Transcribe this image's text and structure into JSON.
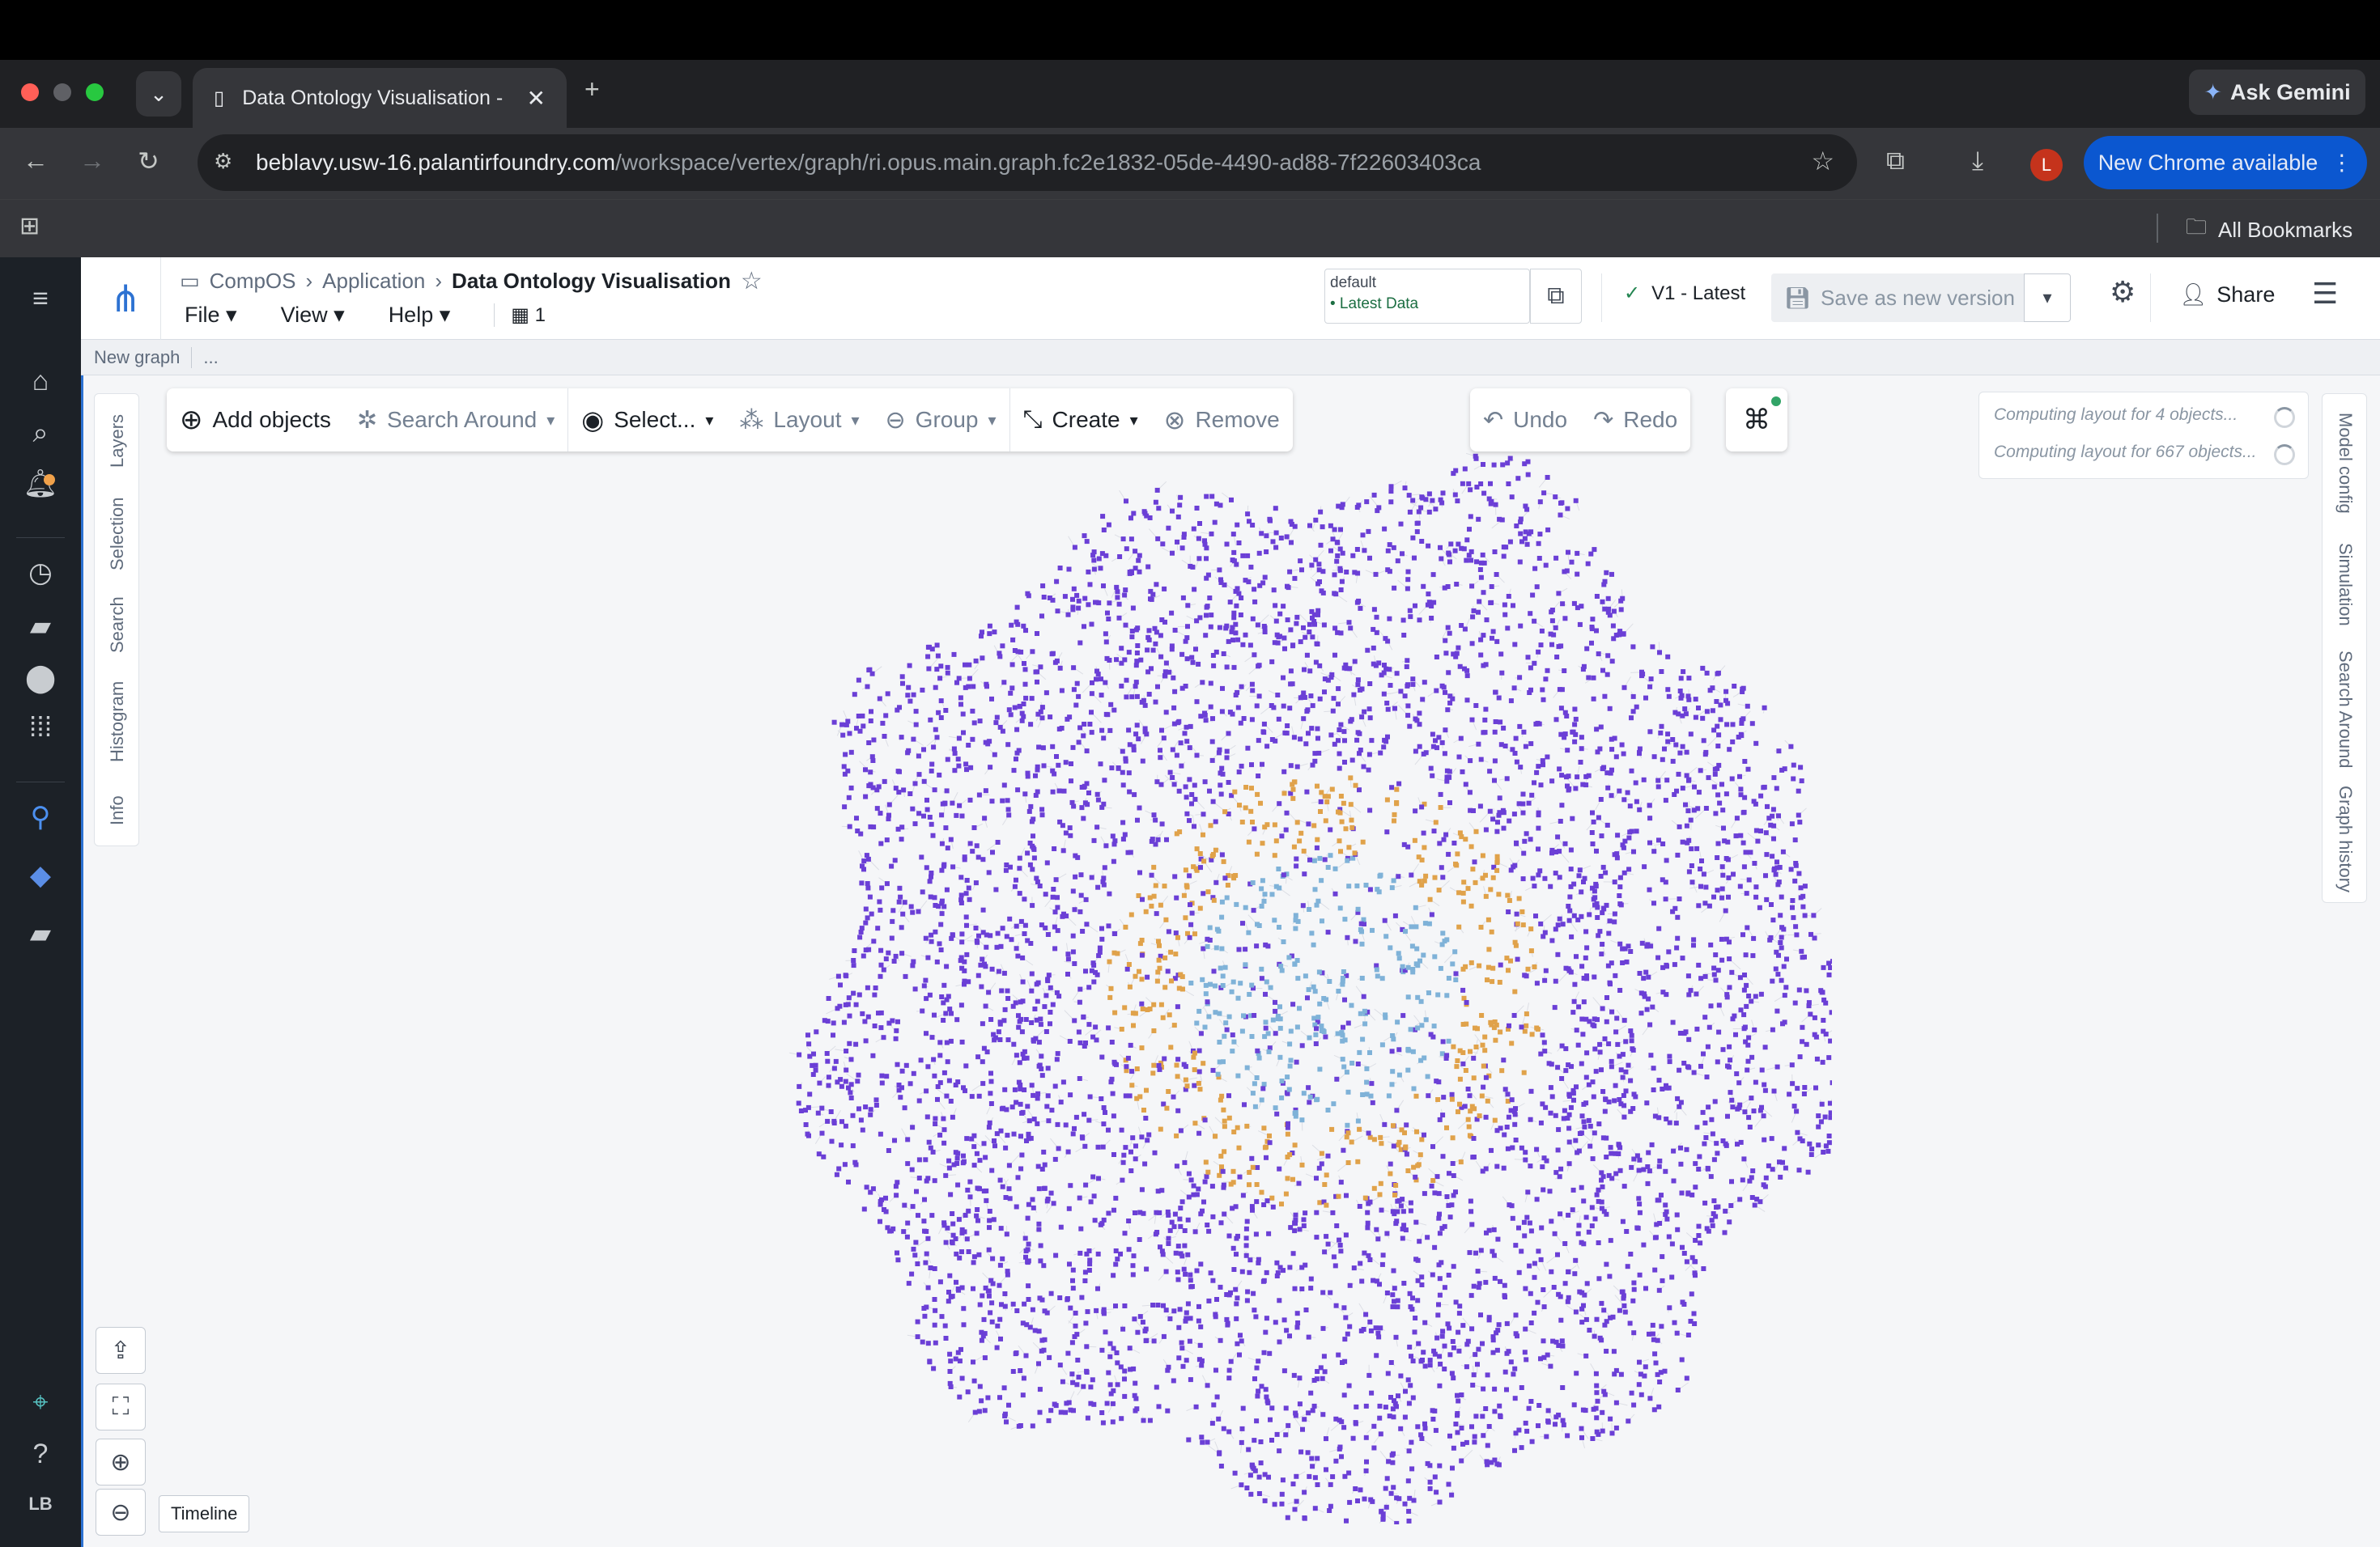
{
  "browser": {
    "tab_title": "Data Ontology Visualisation -",
    "url_host": "beblavy.usw-16.palantirfoundry.com",
    "url_path": "/workspace/vertex/graph/ri.opus.main.graph.fc2e1832-05de-4490-ad88-7f22603403ca",
    "ask_gemini": "Ask Gemini",
    "new_chrome": "New Chrome available",
    "profile_initial": "L",
    "all_bookmarks": "All Bookmarks"
  },
  "leftnav": {
    "user_initials": "LB"
  },
  "header": {
    "breadcrumb": [
      "CompOS",
      "Application"
    ],
    "title": "Data Ontology Visualisation",
    "menus": [
      "File",
      "View",
      "Help"
    ],
    "object_count": "1",
    "scenario_label": "default",
    "scenario_value": "• Latest Data",
    "version": "V1 - Latest",
    "save_label": "Save as new version",
    "share_label": "Share"
  },
  "subheader": {
    "graph_name": "New graph",
    "more": "..."
  },
  "toolbar": {
    "add_objects": "Add objects",
    "search_around": "Search Around",
    "select": "Select...",
    "layout": "Layout",
    "group": "Group",
    "create": "Create",
    "remove": "Remove",
    "undo": "Undo",
    "redo": "Redo"
  },
  "left_tabs": [
    "Layers",
    "Selection",
    "Search",
    "Histogram",
    "Info"
  ],
  "right_tabs": [
    "Model config",
    "Simulation",
    "Search Around",
    "Graph history"
  ],
  "computing": [
    "Computing layout for 4 objects...",
    "Computing layout for 667 objects..."
  ],
  "timeline_label": "Timeline",
  "colors": {
    "node_primary": "#6b3fd6",
    "node_ring": "#e0a24a",
    "node_core": "#7fb2d8",
    "accent": "#2d72d2"
  }
}
